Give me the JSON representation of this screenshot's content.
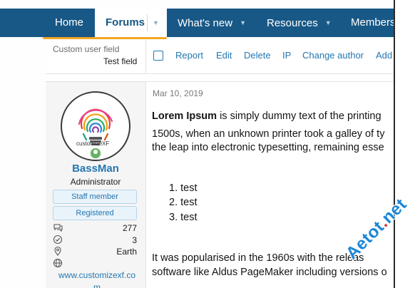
{
  "nav": {
    "items": [
      {
        "label": "Home",
        "has_caret": false
      },
      {
        "label": "Forums",
        "active": true
      },
      {
        "label": "What's new",
        "has_caret": true
      },
      {
        "label": "Resources",
        "has_caret": true
      },
      {
        "label": "Members",
        "has_caret": false
      }
    ],
    "accent_color": "#185886",
    "active_underline_color": "#f5a623"
  },
  "previous_post": {
    "custom_field_label": "Custom user field",
    "custom_field_value": "Test field",
    "actions": [
      "Report",
      "Edit",
      "Delete",
      "IP",
      "Change author",
      "Add"
    ]
  },
  "post": {
    "date": "Mar 10, 2019",
    "user": {
      "avatar_text": "customizeXF",
      "name": "BassMan",
      "title": "Administrator",
      "banners": [
        "Staff member",
        "Registered"
      ],
      "stats": [
        {
          "icon": "messages-icon",
          "value": "277"
        },
        {
          "icon": "reaction-check-icon",
          "value": "3"
        },
        {
          "icon": "location-pin-icon",
          "value": "Earth"
        },
        {
          "icon": "globe-icon",
          "value": ""
        }
      ],
      "website_line1": "www.customizexf.co",
      "website_line2": "m"
    },
    "body": {
      "p1_bold": "Lorem Ipsum",
      "p1_rest": " is simply dummy text of the printing",
      "p1_line2": "1500s, when an unknown printer took a galley of ty",
      "p1_line3": "the leap into electronic typesetting, remaining esse",
      "list": [
        "test",
        "test",
        "test"
      ],
      "p2_line1": "It was popularised in the 1960s with the releas",
      "p2_line2": "software like Aldus PageMaker including versions o"
    }
  },
  "watermark": {
    "text_main": "Aetot",
    "text_dot": ".",
    "text_end": "net"
  }
}
